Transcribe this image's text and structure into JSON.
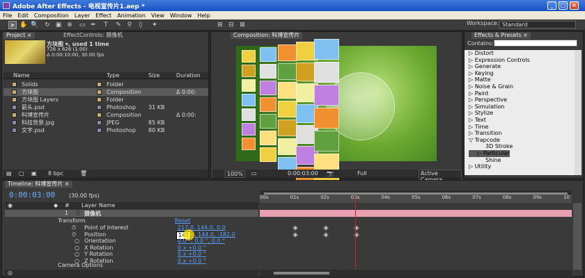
{
  "window": {
    "title": "Adobe After Effects - 电视宣传片1.aep *",
    "min": "_",
    "max": "□",
    "close": "×"
  },
  "menu": [
    "File",
    "Edit",
    "Composition",
    "Layer",
    "Effect",
    "Animation",
    "View",
    "Window",
    "Help"
  ],
  "workspace": {
    "label": "Workspace:",
    "value": "Standard"
  },
  "project": {
    "tabs": [
      "Project ×",
      "EffectControls: 摄像机"
    ],
    "item_name": "方块图 ▾, used 1 time",
    "item_size": "726 x 626 (1.00)",
    "item_time": "Δ 0:00:10:00, 30.00 fps",
    "columns": [
      "Name",
      "Type",
      "Size",
      "Duration"
    ],
    "rows": [
      {
        "name": "Solids",
        "type": "Folder",
        "size": "",
        "dur": "",
        "color": "#c8b070"
      },
      {
        "name": "方块图",
        "type": "Composition",
        "size": "",
        "dur": "Δ 0:00:",
        "color": "#c8b070"
      },
      {
        "name": "方块图 Layers",
        "type": "Folder",
        "size": "",
        "dur": "",
        "color": "#c8b070"
      },
      {
        "name": "箭头.psd",
        "type": "Photoshop",
        "size": "31 KB",
        "dur": "",
        "color": "#8888aa"
      },
      {
        "name": "科博宣传片",
        "type": "Composition",
        "size": "",
        "dur": "Δ 0:00:",
        "color": "#c8b070"
      },
      {
        "name": "科技背景.jpg",
        "type": "JPEG",
        "size": "85 KB",
        "dur": "",
        "color": "#8888aa"
      },
      {
        "name": "文字.psd",
        "type": "Photoshop",
        "size": "80 KB",
        "dur": "",
        "color": "#8888aa"
      }
    ],
    "bpc": "8 bpc"
  },
  "composition": {
    "tab": "Composition: 科博宣传片",
    "zoom": "100%",
    "time": "0:00:03:00",
    "resolution": "Full",
    "camera": "Active Camera"
  },
  "effects": {
    "tab": "Effects & Presets ×",
    "contains_label": "Contains:",
    "items": [
      {
        "label": "▷ Distort",
        "indent": 0
      },
      {
        "label": "▷ Expression Controls",
        "indent": 0
      },
      {
        "label": "▷ Generate",
        "indent": 0
      },
      {
        "label": "▷ Keying",
        "indent": 0
      },
      {
        "label": "▷ Matte",
        "indent": 0
      },
      {
        "label": "▷ Noise & Grain",
        "indent": 0
      },
      {
        "label": "▷ Paint",
        "indent": 0
      },
      {
        "label": "▷ Perspective",
        "indent": 0
      },
      {
        "label": "▷ Simulation",
        "indent": 0
      },
      {
        "label": "▷ Stylize",
        "indent": 0
      },
      {
        "label": "▷ Text",
        "indent": 0
      },
      {
        "label": "▷ Time",
        "indent": 0
      },
      {
        "label": "▷ Transition",
        "indent": 0
      },
      {
        "label": "▽ Trapcode",
        "indent": 0
      },
      {
        "label": "3D Stroke",
        "indent": 2
      },
      {
        "label": "▷ Particular",
        "indent": 1
      },
      {
        "label": "Shine",
        "indent": 2
      },
      {
        "label": "▷ Utility",
        "indent": 0
      }
    ]
  },
  "timeline": {
    "tab": "Timeline: 科博宣传片 ×",
    "time": "0:00:03:00",
    "fps": "(30.00 fps)",
    "ruler": [
      "00s",
      "01s",
      "02s",
      "03s",
      "04s",
      "05s",
      "06s",
      "07s",
      "08s",
      "09s",
      "10"
    ],
    "layer_num": "1",
    "layer_name": "摄像机",
    "layer_name_header": "Layer Name",
    "num_header": "#",
    "transform": "Transform",
    "reset": "Reset",
    "props": [
      {
        "name": "Point of Interest",
        "value": "217.0, 144.0, 0.0",
        "anim": true
      },
      {
        "name": "Position",
        "value": ", 144.0, -182.0",
        "anim": true,
        "edit": "145"
      },
      {
        "name": "Orientation",
        "value": "0.0 °, 0.0 °, 0.0 °",
        "anim": false
      },
      {
        "name": "X Rotation",
        "value": "0 x +0.0 °",
        "anim": false
      },
      {
        "name": "Y Rotation",
        "value": "0 x +0.0 °",
        "anim": false
      },
      {
        "name": "Z Rotation",
        "value": "0 x +0.0 °",
        "anim": false
      }
    ],
    "camera_options": "Camera Options"
  }
}
